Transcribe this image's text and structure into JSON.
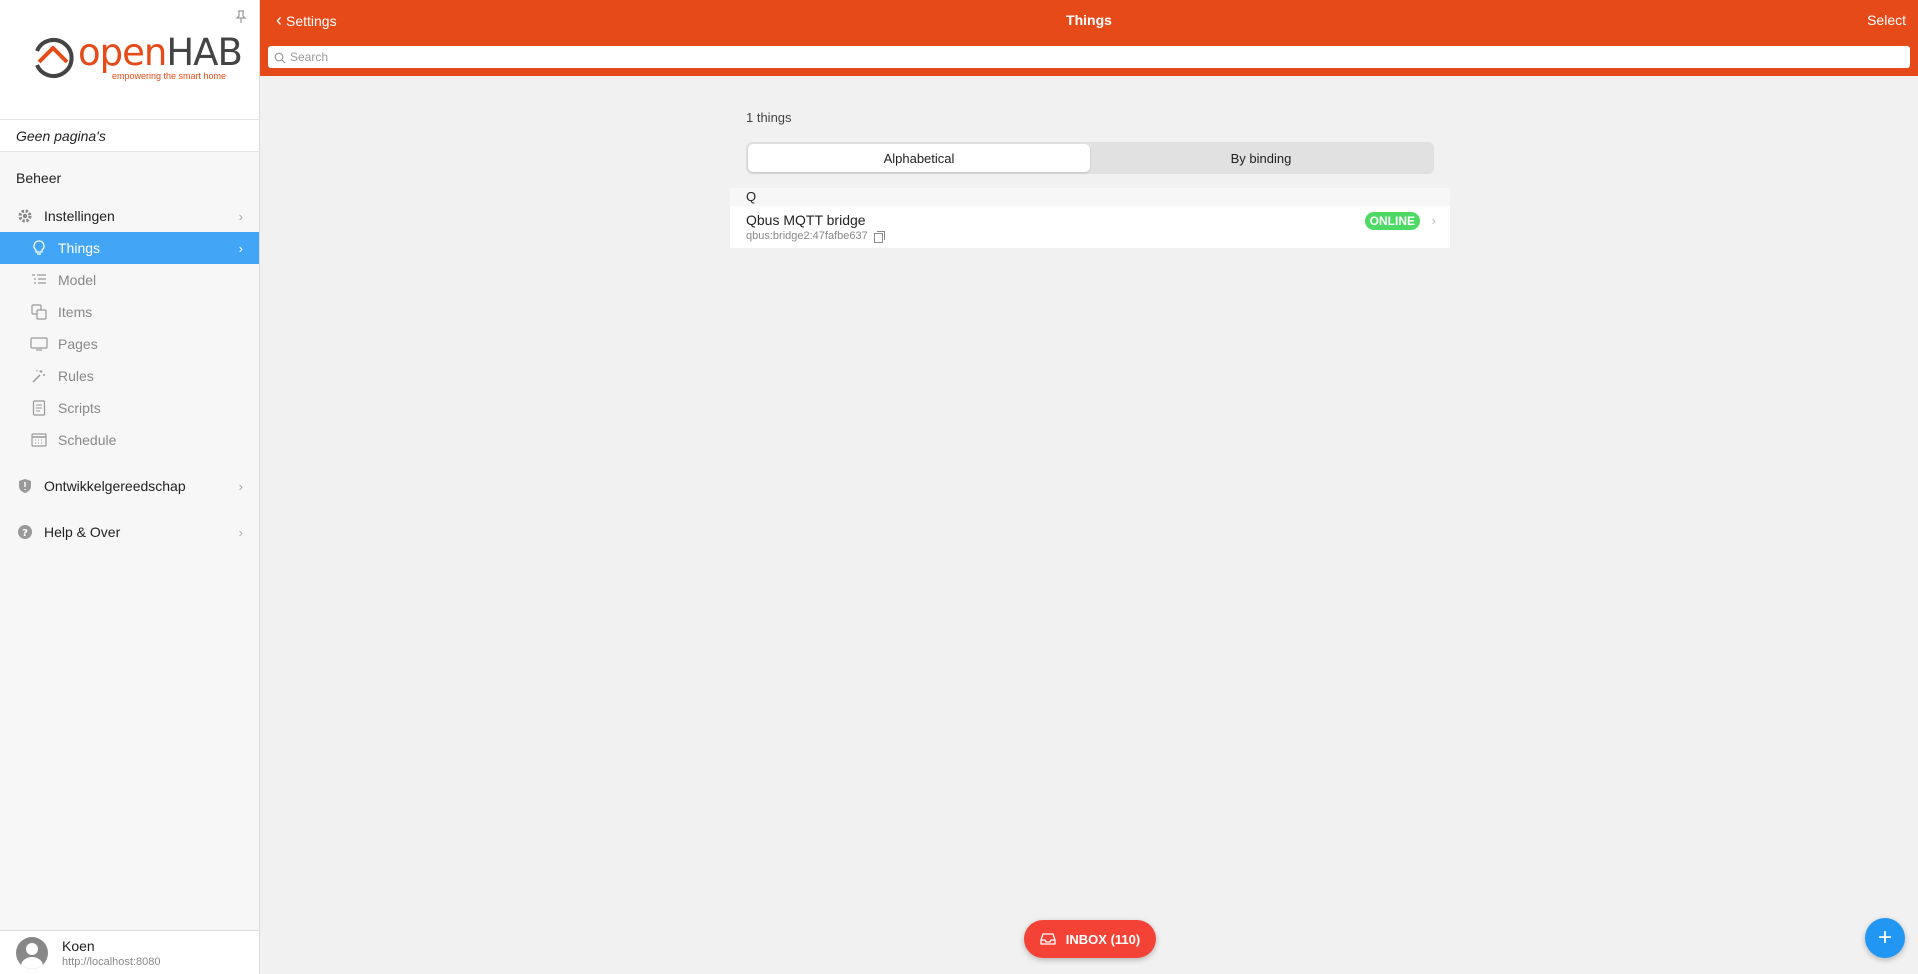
{
  "sidebar": {
    "logo": {
      "word_open": "open",
      "word_hab": "HAB",
      "tagline": "empowering the smart home"
    },
    "no_pages": "Geen pagina's",
    "section_title": "Beheer",
    "items": [
      {
        "label": "Instellingen",
        "icon": "gear-icon"
      },
      {
        "label": "Things",
        "icon": "lightbulb-icon",
        "active": true
      },
      {
        "label": "Model",
        "icon": "model-list-icon"
      },
      {
        "label": "Items",
        "icon": "items-squares-icon"
      },
      {
        "label": "Pages",
        "icon": "monitor-icon"
      },
      {
        "label": "Rules",
        "icon": "wand-icon"
      },
      {
        "label": "Scripts",
        "icon": "script-document-icon"
      },
      {
        "label": "Schedule",
        "icon": "calendar-icon"
      },
      {
        "label": "Ontwikkelgereedschap",
        "icon": "shield-icon"
      },
      {
        "label": "Help & Over",
        "icon": "help-circle-icon"
      }
    ],
    "user": {
      "name": "Koen",
      "url": "http://localhost:8080"
    }
  },
  "topbar": {
    "back_label": "Settings",
    "title": "Things",
    "select_label": "Select",
    "search_placeholder": "Search"
  },
  "main": {
    "count_label": "1 things",
    "segments": [
      {
        "label": "Alphabetical",
        "active": true
      },
      {
        "label": "By binding",
        "active": false
      }
    ],
    "groups": [
      {
        "letter": "Q",
        "things": [
          {
            "title": "Qbus MQTT bridge",
            "uid": "qbus:bridge2:47fafbe637",
            "status": "ONLINE"
          }
        ]
      }
    ]
  },
  "inbox_label": "INBOX (110)",
  "fab_label": "+",
  "colors": {
    "brand": "#e64a19",
    "active_nav": "#42a5f5",
    "online": "#4cd964",
    "inbox": "#f44336",
    "fab": "#2196f3"
  }
}
